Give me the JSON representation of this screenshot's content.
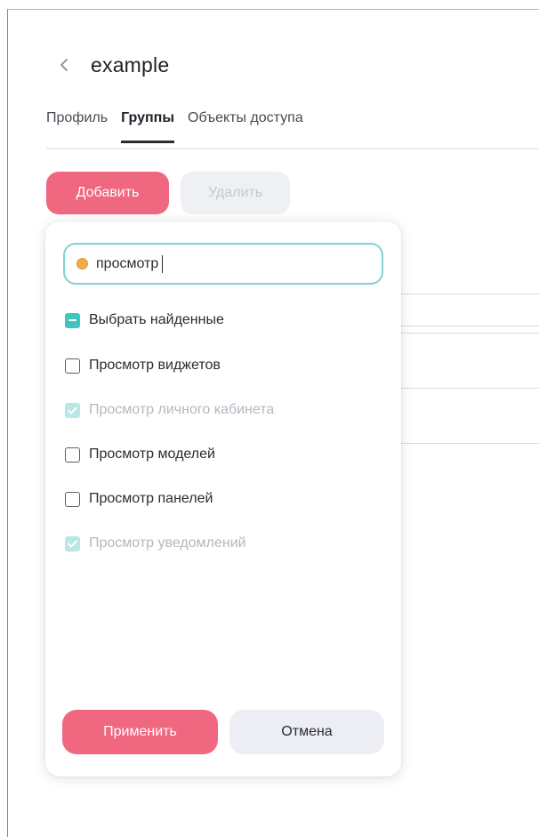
{
  "header": {
    "back_icon": "chevron-left-icon",
    "title": "example"
  },
  "tabs": [
    {
      "label": "Профиль",
      "active": false
    },
    {
      "label": "Группы",
      "active": true
    },
    {
      "label": "Объекты доступа",
      "active": false
    }
  ],
  "toolbar": {
    "add_label": "Добавить",
    "delete_label": "Удалить"
  },
  "popup": {
    "search": {
      "value": "просмотр",
      "status_color": "#f0ac45"
    },
    "select_found": {
      "label": "Выбрать найденные",
      "state": "indeterminate"
    },
    "items": [
      {
        "label": "Просмотр виджетов",
        "checked": false,
        "disabled": false
      },
      {
        "label": "Просмотр личного кабинета",
        "checked": true,
        "disabled": true
      },
      {
        "label": "Просмотр моделей",
        "checked": false,
        "disabled": false
      },
      {
        "label": "Просмотр панелей",
        "checked": false,
        "disabled": false
      },
      {
        "label": "Просмотр уведомлений",
        "checked": true,
        "disabled": true
      }
    ],
    "apply_label": "Применить",
    "cancel_label": "Отмена"
  },
  "colors": {
    "accent": "#f06780",
    "teal": "#3ec5c0",
    "teal_light": "#b9e6e6",
    "input_border": "#7fd3d0"
  }
}
